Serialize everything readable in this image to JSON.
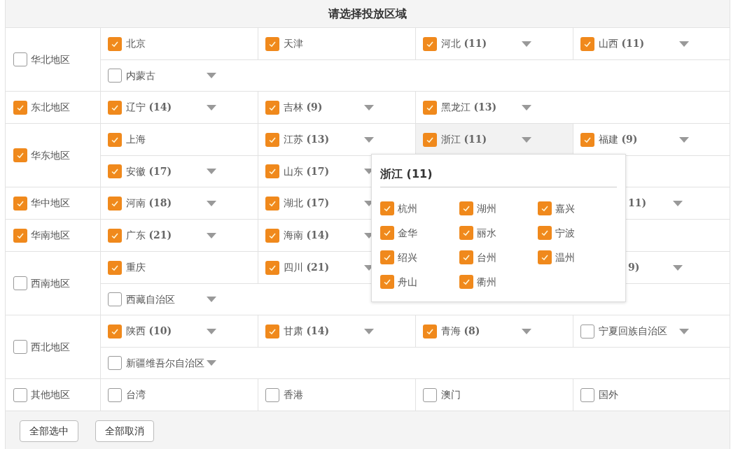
{
  "title": "请选择投放区域",
  "regions": [
    {
      "name": "华北地区",
      "checked": false,
      "lines": [
        [
          {
            "kind": "province",
            "label": "北京",
            "checked": true,
            "has_menu": false,
            "expanded": false
          },
          {
            "kind": "province",
            "label": "天津",
            "checked": true,
            "has_menu": false,
            "expanded": false
          },
          {
            "kind": "province",
            "label": "河北 **(11)**",
            "checked": true,
            "has_menu": true,
            "expanded": false
          },
          {
            "kind": "province",
            "label": "山西 **(11)**",
            "checked": true,
            "has_menu": true,
            "expanded": false
          }
        ],
        [
          {
            "kind": "province",
            "label": "内蒙古",
            "checked": false,
            "has_menu": true,
            "expanded": false
          }
        ]
      ]
    },
    {
      "name": "东北地区",
      "checked": true,
      "lines": [
        [
          {
            "kind": "province",
            "label": "辽宁 **(14)**",
            "checked": true,
            "has_menu": true,
            "expanded": false
          },
          {
            "kind": "province",
            "label": "吉林 **(9)**",
            "checked": true,
            "has_menu": true,
            "expanded": false
          },
          {
            "kind": "province",
            "label": "黑龙江 **(13)**",
            "checked": true,
            "has_menu": true,
            "expanded": false
          }
        ]
      ]
    },
    {
      "name": "华东地区",
      "checked": true,
      "lines": [
        [
          {
            "kind": "province",
            "label": "上海",
            "checked": true,
            "has_menu": false,
            "expanded": false
          },
          {
            "kind": "province",
            "label": "江苏 **(13)**",
            "checked": true,
            "has_menu": true,
            "expanded": false
          },
          {
            "kind": "province",
            "label": "浙江 **(11)**",
            "checked": true,
            "has_menu": true,
            "expanded": true
          },
          {
            "kind": "province",
            "label": "福建 **(9)**",
            "checked": true,
            "has_menu": true,
            "expanded": false
          }
        ],
        [
          {
            "kind": "province",
            "label": "安徽 **(17)**",
            "checked": true,
            "has_menu": true,
            "expanded": false
          },
          {
            "kind": "province",
            "label": "山东 **(17)**",
            "checked": true,
            "has_menu": true,
            "expanded": false
          },
          {
            "kind": "hidden"
          }
        ]
      ]
    },
    {
      "name": "华中地区",
      "checked": true,
      "lines": [
        [
          {
            "kind": "province",
            "label": "河南 **(18)**",
            "checked": true,
            "has_menu": true,
            "expanded": false
          },
          {
            "kind": "province",
            "label": "湖北 **(17)**",
            "checked": true,
            "has_menu": true,
            "expanded": false
          },
          {
            "kind": "hidden"
          },
          {
            "kind": "covered",
            "label": "11)"
          }
        ]
      ]
    },
    {
      "name": "华南地区",
      "checked": true,
      "lines": [
        [
          {
            "kind": "province",
            "label": "广东 **(21)**",
            "checked": true,
            "has_menu": true,
            "expanded": false
          },
          {
            "kind": "province",
            "label": "海南 **(14)**",
            "checked": true,
            "has_menu": true,
            "expanded": false
          },
          {
            "kind": "hidden"
          }
        ]
      ]
    },
    {
      "name": "西南地区",
      "checked": false,
      "lines": [
        [
          {
            "kind": "province",
            "label": "重庆",
            "checked": true,
            "has_menu": false,
            "expanded": false
          },
          {
            "kind": "province",
            "label": "四川 **(21)**",
            "checked": true,
            "has_menu": true,
            "expanded": false
          },
          {
            "kind": "hidden"
          },
          {
            "kind": "covered",
            "label": "9)"
          }
        ],
        [
          {
            "kind": "province",
            "label": "西藏自治区",
            "checked": false,
            "has_menu": true,
            "expanded": false
          }
        ]
      ]
    },
    {
      "name": "西北地区",
      "checked": false,
      "lines": [
        [
          {
            "kind": "province",
            "label": "陕西 **(10)**",
            "checked": true,
            "has_menu": true,
            "expanded": false
          },
          {
            "kind": "province",
            "label": "甘肃 **(14)**",
            "checked": true,
            "has_menu": true,
            "expanded": false
          },
          {
            "kind": "province",
            "label": "青海 **(8)**",
            "checked": true,
            "has_menu": true,
            "expanded": false
          },
          {
            "kind": "province",
            "label": "宁夏回族自治区",
            "checked": false,
            "has_menu": true,
            "expanded": false
          }
        ],
        [
          {
            "kind": "province",
            "label": "新疆维吾尔自治区",
            "checked": false,
            "has_menu": true,
            "expanded": false
          }
        ]
      ]
    },
    {
      "name": "其他地区",
      "checked": false,
      "lines": [
        [
          {
            "kind": "province",
            "label": "台湾",
            "checked": false,
            "has_menu": false,
            "expanded": false
          },
          {
            "kind": "province",
            "label": "香港",
            "checked": false,
            "has_menu": false,
            "expanded": false
          },
          {
            "kind": "province",
            "label": "澳门",
            "checked": false,
            "has_menu": false,
            "expanded": false
          },
          {
            "kind": "province",
            "label": "国外",
            "checked": false,
            "has_menu": false,
            "expanded": false
          }
        ]
      ]
    }
  ],
  "popup": {
    "title": "浙江 (11)",
    "cities": [
      {
        "label": "杭州",
        "checked": true
      },
      {
        "label": "湖州",
        "checked": true
      },
      {
        "label": "嘉兴",
        "checked": true
      },
      {
        "label": "金华",
        "checked": true
      },
      {
        "label": "丽水",
        "checked": true
      },
      {
        "label": "宁波",
        "checked": true
      },
      {
        "label": "绍兴",
        "checked": true
      },
      {
        "label": "台州",
        "checked": true
      },
      {
        "label": "温州",
        "checked": true
      },
      {
        "label": "舟山",
        "checked": true
      },
      {
        "label": "衢州",
        "checked": true
      }
    ]
  },
  "buttons": [
    "全部选中",
    "全部取消"
  ]
}
